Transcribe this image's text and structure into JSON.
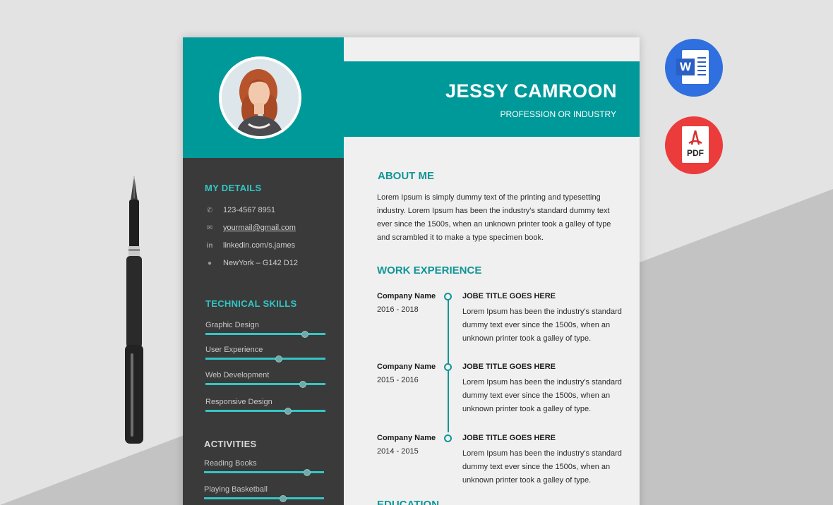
{
  "header": {
    "name": "JESSY CAMROON",
    "profession": "PROFESSION OR INDUSTRY"
  },
  "sidebar": {
    "details_title": "MY DETAILS",
    "details": [
      {
        "icon": "phone-icon",
        "text": "123-4567 8951"
      },
      {
        "icon": "mail-icon",
        "text": "yourmail@gmail.com"
      },
      {
        "icon": "linkedin-icon",
        "text": "linkedin.com/s.james"
      },
      {
        "icon": "location-pin-icon",
        "text": "NewYork – G142 D12"
      }
    ],
    "skills_title": "TECHNICAL SKILLS",
    "skills": [
      {
        "label": "Graphic Design",
        "level": 0.83
      },
      {
        "label": "User Experience",
        "level": 0.61
      },
      {
        "label": "Web Development",
        "level": 0.81
      },
      {
        "label": "Responsive Design",
        "level": 0.69
      }
    ],
    "activities_title": "ACTIVITIES",
    "activities": [
      {
        "label": "Reading Books",
        "level": 0.86
      },
      {
        "label": "Playing Basketball",
        "level": 0.66
      }
    ]
  },
  "about": {
    "title": "ABOUT ME",
    "text": "Lorem Ipsum is simply dummy text of the printing and typesetting industry. Lorem Ipsum has been the industry's standard dummy text ever since the 1500s, when an unknown printer took a galley of type and scrambled it to make a type specimen book."
  },
  "work": {
    "title": "WORK EXPERIENCE",
    "jobs": [
      {
        "company": "Company Name",
        "years": "2016 - 2018",
        "title": "JOBE TITLE GOES HERE",
        "desc": "Lorem Ipsum has been the industry's standard dummy text ever since the 1500s, when an unknown printer took a galley of type."
      },
      {
        "company": "Company Name",
        "years": "2015 - 2016",
        "title": "JOBE TITLE GOES HERE",
        "desc": "Lorem Ipsum has been the industry's standard dummy text ever since the 1500s, when an unknown printer took a galley of type."
      },
      {
        "company": "Company Name",
        "years": "2014 - 2015",
        "title": "JOBE TITLE GOES HERE",
        "desc": "Lorem Ipsum has been the industry's standard dummy text ever since the 1500s, when an unknown printer took a galley of type."
      }
    ]
  },
  "education": {
    "title": "EDUCATION"
  },
  "badges": {
    "word_letter": "W",
    "pdf_label": "PDF",
    "word_color": "#2f6fe0",
    "pdf_color": "#ec3b3b"
  },
  "colors": {
    "accent": "#009999",
    "sidebar": "#3a3a3a"
  }
}
